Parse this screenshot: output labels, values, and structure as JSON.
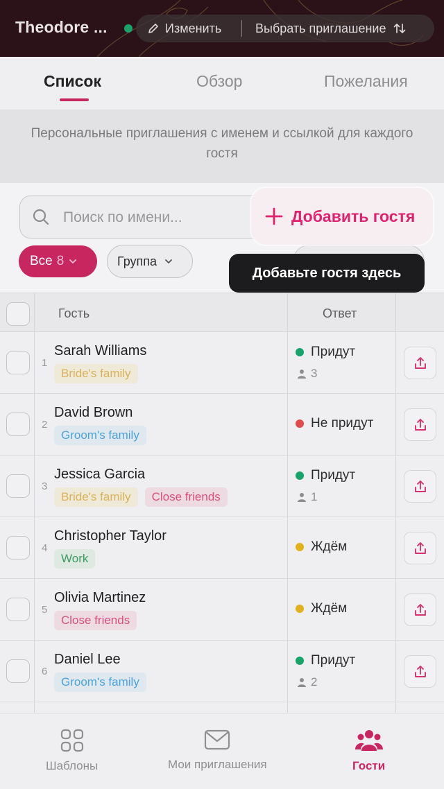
{
  "header": {
    "title": "Theodore ...",
    "edit_label": "Изменить",
    "choose_invitation_label": "Выбрать приглашение"
  },
  "tabs": [
    {
      "label": "Список",
      "active": true
    },
    {
      "label": "Обзор",
      "active": false
    },
    {
      "label": "Пожелания",
      "active": false
    }
  ],
  "info_banner": "Персональные приглашения с именем и ссылкой для каждого гостя",
  "search": {
    "placeholder": "Поиск по имени..."
  },
  "add_guest_label": "Добавить гостя",
  "tooltip": "Добавьте гостя здесь",
  "filters": {
    "all_label": "Все",
    "all_count": "8",
    "group_label": "Группа"
  },
  "table": {
    "headers": {
      "guest": "Гость",
      "response": "Ответ"
    },
    "rows": [
      {
        "num": "1",
        "name": "Sarah Williams",
        "tags": [
          {
            "text": "Bride's family",
            "kind": "bride"
          }
        ],
        "status": "Придут",
        "status_color": "#17a36a",
        "attendees": "3"
      },
      {
        "num": "2",
        "name": "David Brown",
        "tags": [
          {
            "text": "Groom's family",
            "kind": "groom"
          }
        ],
        "status": "Не придут",
        "status_color": "#e04b4b",
        "attendees": ""
      },
      {
        "num": "3",
        "name": "Jessica Garcia",
        "tags": [
          {
            "text": "Bride's family",
            "kind": "bride"
          },
          {
            "text": "Close friends",
            "kind": "friends"
          }
        ],
        "status": "Придут",
        "status_color": "#17a36a",
        "attendees": "1"
      },
      {
        "num": "4",
        "name": "Christopher Taylor",
        "tags": [
          {
            "text": "Work",
            "kind": "work"
          }
        ],
        "status": "Ждём",
        "status_color": "#e0b21b",
        "attendees": ""
      },
      {
        "num": "5",
        "name": "Olivia Martinez",
        "tags": [
          {
            "text": "Close friends",
            "kind": "friends"
          }
        ],
        "status": "Ждём",
        "status_color": "#e0b21b",
        "attendees": ""
      },
      {
        "num": "6",
        "name": "Daniel Lee",
        "tags": [
          {
            "text": "Groom's family",
            "kind": "groom"
          }
        ],
        "status": "Придут",
        "status_color": "#17a36a",
        "attendees": "2"
      }
    ]
  },
  "bottom_nav": [
    {
      "label": "Шаблоны",
      "icon": "grid-icon",
      "active": false
    },
    {
      "label": "Мои приглашения",
      "icon": "envelope-icon",
      "active": false
    },
    {
      "label": "Гости",
      "icon": "people-icon",
      "active": true
    }
  ],
  "colors": {
    "accent": "#c7265f",
    "accent_bright": "#e0216e",
    "online": "#17a36a"
  }
}
